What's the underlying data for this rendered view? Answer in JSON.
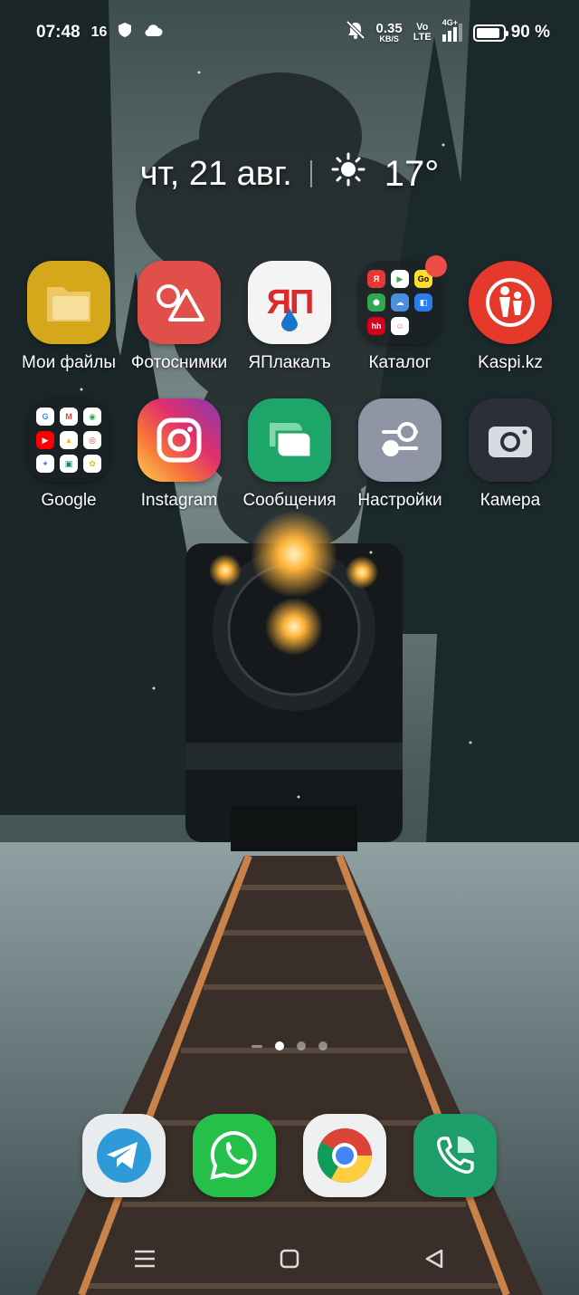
{
  "status_bar": {
    "time": "07:48",
    "notif_count": "16",
    "net_speed_value": "0.35",
    "net_speed_unit": "KB/S",
    "volte_top": "Vo",
    "volte_bottom": "LTE",
    "network": "4G+",
    "battery_percent": "90 %",
    "battery_level": 0.9,
    "icons": [
      "shield-icon",
      "cloud-icon",
      "bell-off-icon",
      "signal-icon",
      "battery-icon"
    ]
  },
  "widget": {
    "date": "чт, 21 авг.",
    "temperature": "17°",
    "weather_icon": "sun-icon"
  },
  "apps": [
    {
      "label": "Мои файлы",
      "icon": "folder-files-icon"
    },
    {
      "label": "Фотоснимки",
      "icon": "photos-icon"
    },
    {
      "label": "ЯПлакалъ",
      "icon": "yaplakal-icon",
      "icon_text": "ЯП"
    },
    {
      "label": "Каталог",
      "icon": "catalog-folder-icon",
      "has_badge": true
    },
    {
      "label": "Kaspi.kz",
      "icon": "kaspi-icon"
    },
    {
      "label": "Google",
      "icon": "google-folder-icon"
    },
    {
      "label": "Instagram",
      "icon": "instagram-icon"
    },
    {
      "label": "Сообщения",
      "icon": "messages-icon"
    },
    {
      "label": "Настройки",
      "icon": "settings-icon"
    },
    {
      "label": "Камера",
      "icon": "camera-icon"
    }
  ],
  "catalog_folder_minis": [
    "Я",
    "▶",
    "Go",
    "⬢",
    "☁",
    "◧",
    "hh",
    "☺",
    ""
  ],
  "page_indicator": {
    "pages": 3,
    "active": 0
  },
  "dock": [
    {
      "name": "telegram",
      "icon": "telegram-icon"
    },
    {
      "name": "whatsapp",
      "icon": "whatsapp-icon"
    },
    {
      "name": "chrome",
      "icon": "chrome-icon"
    },
    {
      "name": "phone",
      "icon": "phone-icon"
    }
  ],
  "nav": [
    "menu-icon",
    "home-icon",
    "back-icon"
  ],
  "colors": {
    "files": "#d4a81a",
    "photos": "#e04f49",
    "kaspi": "#e5392c",
    "messages": "#1ea56a",
    "settings": "#8f95a4",
    "camera": "#2a2f3a",
    "telegram": "#2e9bd8",
    "whatsapp": "#25c04a",
    "phone": "#1e9e6a"
  }
}
